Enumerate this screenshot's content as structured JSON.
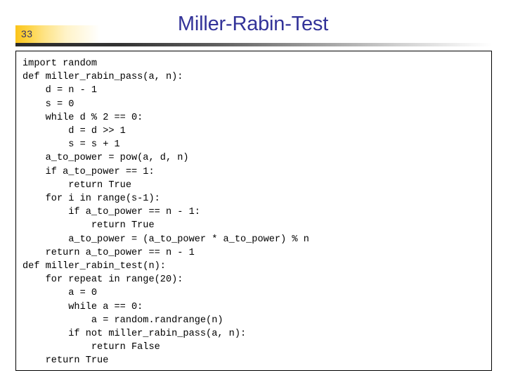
{
  "slide": {
    "page_number": "33",
    "title": "Miller-Rabin-Test",
    "accent_color": "#333399",
    "badge_color": "#fbc41b",
    "rule_color": "#2b2b2b",
    "code_border_color": "#000000"
  },
  "code": {
    "language": "python",
    "lines": [
      "import random",
      "def miller_rabin_pass(a, n):",
      "    d = n - 1",
      "    s = 0",
      "    while d % 2 == 0:",
      "        d = d >> 1",
      "        s = s + 1",
      "    a_to_power = pow(a, d, n)",
      "    if a_to_power == 1:",
      "        return True",
      "    for i in range(s-1):",
      "        if a_to_power == n - 1:",
      "            return True",
      "        a_to_power = (a_to_power * a_to_power) % n",
      "    return a_to_power == n - 1",
      "def miller_rabin_test(n):",
      "    for repeat in range(20):",
      "        a = 0",
      "        while a == 0:",
      "            a = random.randrange(n)",
      "        if not miller_rabin_pass(a, n):",
      "            return False",
      "    return True"
    ],
    "text": "import random\ndef miller_rabin_pass(a, n):\n    d = n - 1\n    s = 0\n    while d % 2 == 0:\n        d = d >> 1\n        s = s + 1\n    a_to_power = pow(a, d, n)\n    if a_to_power == 1:\n        return True\n    for i in range(s-1):\n        if a_to_power == n - 1:\n            return True\n        a_to_power = (a_to_power * a_to_power) % n\n    return a_to_power == n - 1\ndef miller_rabin_test(n):\n    for repeat in range(20):\n        a = 0\n        while a == 0:\n            a = random.randrange(n)\n        if not miller_rabin_pass(a, n):\n            return False\n    return True"
  }
}
